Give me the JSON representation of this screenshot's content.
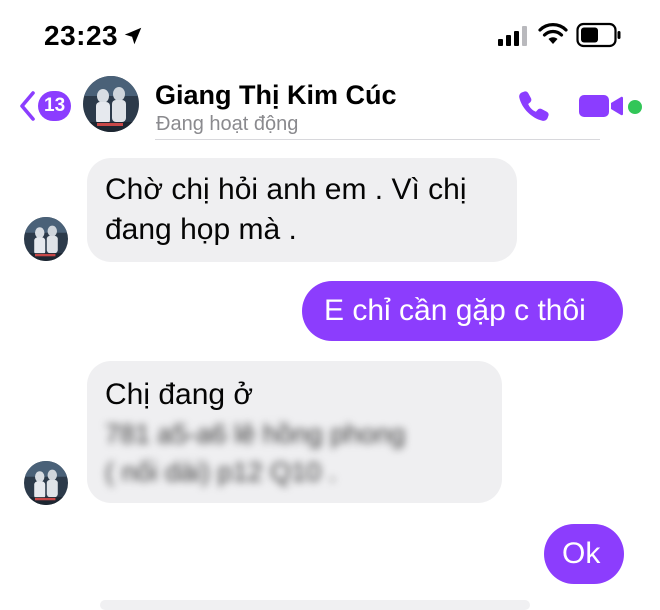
{
  "status_bar": {
    "time": "23:23",
    "icons": [
      "location-arrow-icon",
      "cellular-signal-icon",
      "wifi-icon",
      "battery-icon"
    ]
  },
  "header": {
    "back_badge": "13",
    "contact_name": "Giang Thị Kim Cúc",
    "contact_status": "Đang hoạt động",
    "icons": [
      "chevron-left-icon",
      "phone-icon",
      "video-camera-icon"
    ],
    "accent_color": "#8b3dff",
    "online_color": "#32c658"
  },
  "messages": [
    {
      "direction": "incoming",
      "lines": [
        "Chờ chị hỏi anh em . Vì chị",
        "đang họp mà ."
      ]
    },
    {
      "direction": "outgoing",
      "text": "E chỉ cần gặp c thôi"
    },
    {
      "direction": "incoming",
      "lines": [
        "Chị đang ở",
        "781 a5-a6 lê hồng phong",
        "( nối dài) p12 Q10 ."
      ],
      "blurred_lines": [
        1,
        2
      ]
    },
    {
      "direction": "outgoing",
      "text": "Ok"
    }
  ],
  "colors": {
    "outgoing_bubble": "#8c3dfd",
    "incoming_bubble": "#efeff1"
  }
}
